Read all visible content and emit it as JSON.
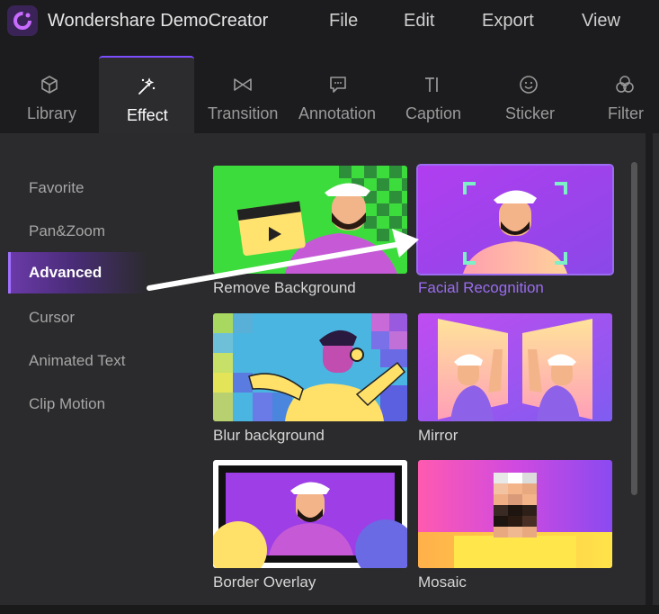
{
  "app": {
    "title": "Wondershare DemoCreator"
  },
  "menu": [
    "File",
    "Edit",
    "Export",
    "View"
  ],
  "tabs": [
    {
      "label": "Library",
      "icon": "cube-icon"
    },
    {
      "label": "Effect",
      "icon": "magic-wand-icon",
      "active": true
    },
    {
      "label": "Transition",
      "icon": "bowtie-icon"
    },
    {
      "label": "Annotation",
      "icon": "speech-bubble-icon"
    },
    {
      "label": "Caption",
      "icon": "text-icon"
    },
    {
      "label": "Sticker",
      "icon": "smiley-icon"
    },
    {
      "label": "Filter",
      "icon": "circles-icon"
    }
  ],
  "sidebar": {
    "items": [
      {
        "label": "Favorite"
      },
      {
        "label": "Pan&Zoom"
      },
      {
        "label": "Advanced",
        "active": true
      },
      {
        "label": "Cursor"
      },
      {
        "label": "Animated Text"
      },
      {
        "label": "Clip Motion"
      }
    ]
  },
  "effects": [
    {
      "label": "Remove Background"
    },
    {
      "label": "Facial Recognition",
      "selected": true
    },
    {
      "label": "Blur background"
    },
    {
      "label": "Mirror"
    },
    {
      "label": "Border Overlay"
    },
    {
      "label": "Mosaic"
    }
  ],
  "colors": {
    "accent": "#7c4dff",
    "selected": "#9b6cf0"
  }
}
